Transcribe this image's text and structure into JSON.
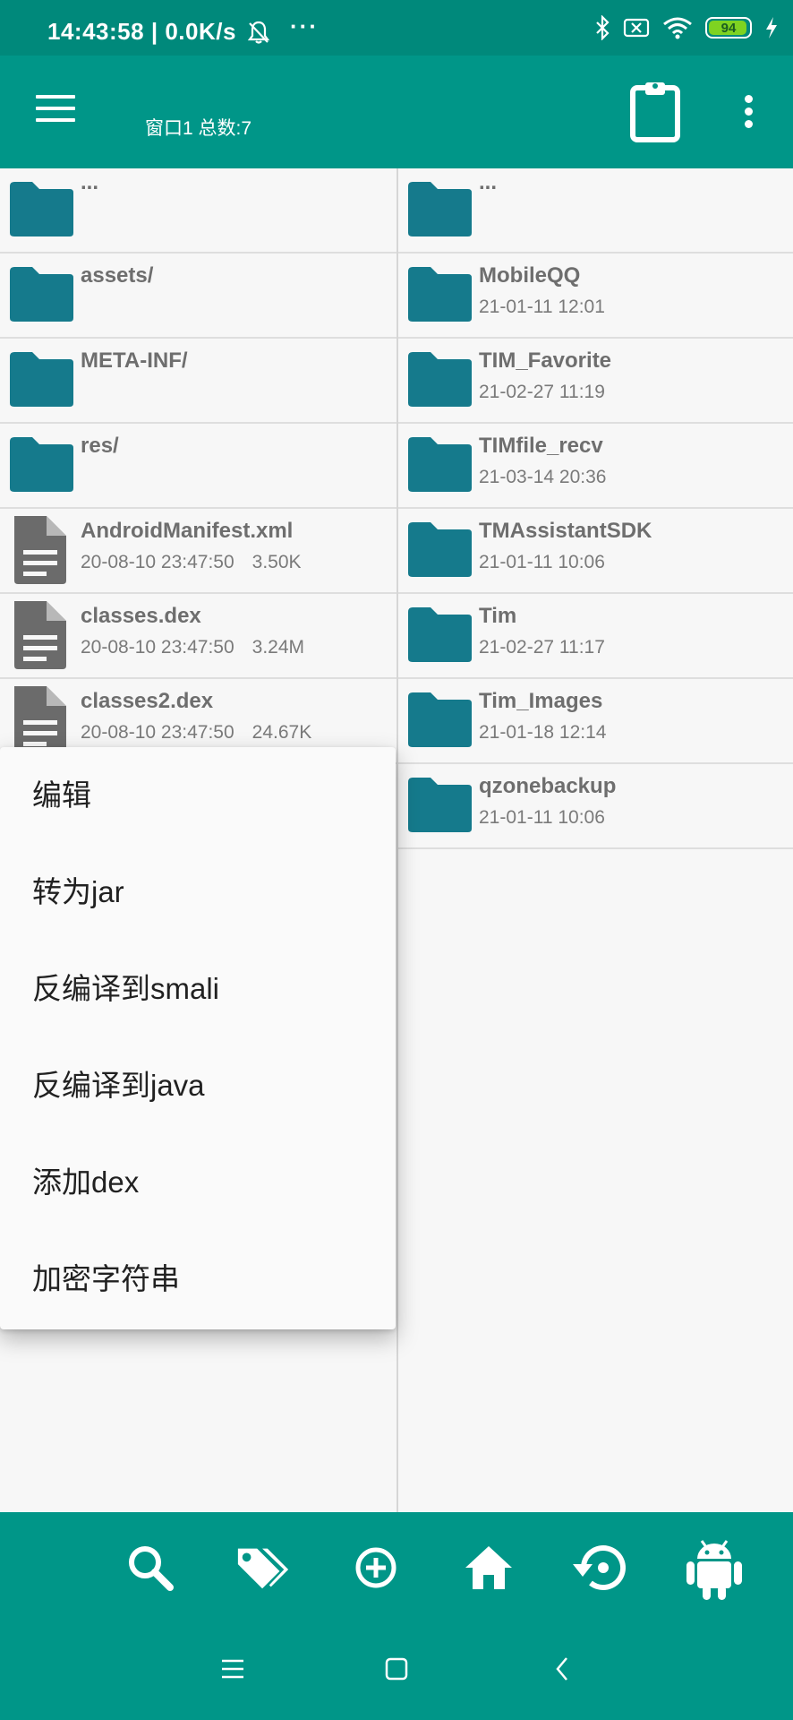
{
  "status_bar": {
    "time": "14:43:58",
    "net_speed": "0.0K/s",
    "separator": "|",
    "more_dots": "···",
    "battery_level": "94"
  },
  "app_bar": {
    "title": "窗口1 总数:7"
  },
  "left_pane": {
    "rows": [
      {
        "name": "...",
        "meta": "",
        "size": "",
        "icon": "folder-icon"
      },
      {
        "name": "assets/",
        "meta": "",
        "size": "",
        "icon": "folder-icon"
      },
      {
        "name": "META-INF/",
        "meta": "",
        "size": "",
        "icon": "folder-icon"
      },
      {
        "name": "res/",
        "meta": "",
        "size": "",
        "icon": "folder-icon"
      },
      {
        "name": "AndroidManifest.xml",
        "meta": "20-08-10 23:47:50",
        "size": "3.50K",
        "icon": "file-icon"
      },
      {
        "name": "classes.dex",
        "meta": "20-08-10 23:47:50",
        "size": "3.24M",
        "icon": "file-icon"
      },
      {
        "name": "classes2.dex",
        "meta": "20-08-10 23:47:50",
        "size": "24.67K",
        "icon": "file-icon"
      }
    ]
  },
  "right_pane": {
    "rows": [
      {
        "name": "...",
        "meta": ""
      },
      {
        "name": "MobileQQ",
        "meta": "21-01-11 12:01"
      },
      {
        "name": "TIM_Favorite",
        "meta": "21-02-27 11:19"
      },
      {
        "name": "TIMfile_recv",
        "meta": "21-03-14 20:36"
      },
      {
        "name": "TMAssistantSDK",
        "meta": "21-01-11 10:06"
      },
      {
        "name": "Tim",
        "meta": "21-02-27 11:17"
      },
      {
        "name": "Tim_Images",
        "meta": "21-01-18 12:14"
      },
      {
        "name": "qzonebackup",
        "meta": "21-01-11 10:06"
      }
    ]
  },
  "context_menu": {
    "items": [
      "编辑",
      "转为jar",
      "反编译到smali",
      "反编译到java",
      "添加dex",
      "加密字符串"
    ]
  },
  "bottom_bar": {
    "icons": [
      "search-icon",
      "tags-icon",
      "add-circle-icon",
      "home-icon",
      "restore-icon",
      "android-icon"
    ]
  },
  "colors": {
    "primary": "#009688",
    "status_bar": "#00897b",
    "folder": "#157a8c",
    "file": "#6b6b6b"
  }
}
